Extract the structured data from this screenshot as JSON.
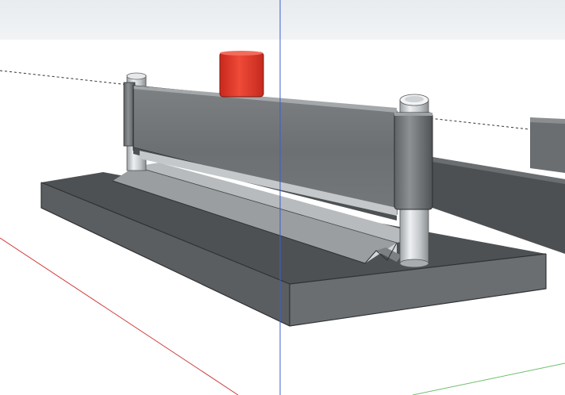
{
  "app": {
    "view": "3d-model-viewport"
  },
  "scene": {
    "sky_color": "#eef1f4",
    "ground_color": "#ffffff",
    "axes": {
      "red_color": "#cc3333",
      "green_color": "#66aa66",
      "blue_color": "#3355cc"
    },
    "model": {
      "base_color": "#5b5d5d",
      "post_color": "#cfd3d6",
      "rail_color": "#8a8e90",
      "red_block_color": "#e5392b"
    }
  }
}
